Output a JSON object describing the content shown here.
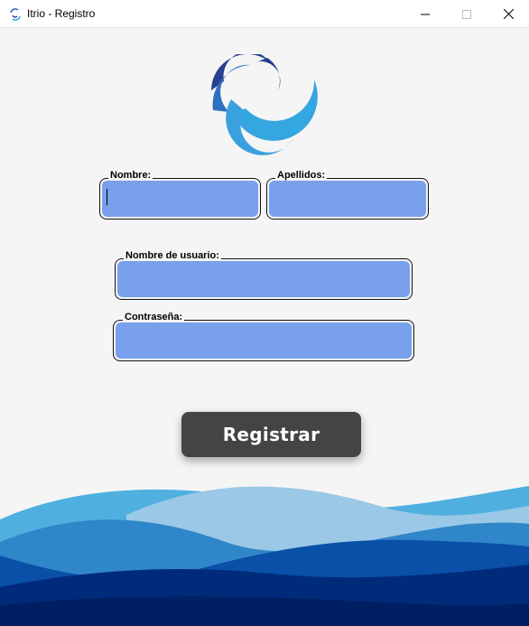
{
  "window": {
    "title": "Itrio - Registro",
    "controls": [
      "minimize",
      "maximize",
      "close"
    ]
  },
  "logo": {
    "icon": "swirl-logo-icon",
    "colors": [
      "#2b3f8f",
      "#2e6fc2",
      "#35a7e0"
    ]
  },
  "form": {
    "nombre": {
      "label": "Nombre:",
      "value": "",
      "placeholder": ""
    },
    "apellidos": {
      "label": "Apellidos:",
      "value": "",
      "placeholder": ""
    },
    "usuario": {
      "label": "Nombre de usuario:",
      "value": "",
      "placeholder": ""
    },
    "contrasena": {
      "label": "Contraseña:",
      "value": "",
      "placeholder": ""
    },
    "input_color": "#78a0eb"
  },
  "register_button": {
    "label": "Registrar",
    "color": "#444444"
  },
  "footer": {
    "decoration": "blue-waves",
    "colors": [
      "#4fb0e0",
      "#9ac8e6",
      "#2f86c8",
      "#0a4fa8",
      "#002b7a"
    ]
  }
}
